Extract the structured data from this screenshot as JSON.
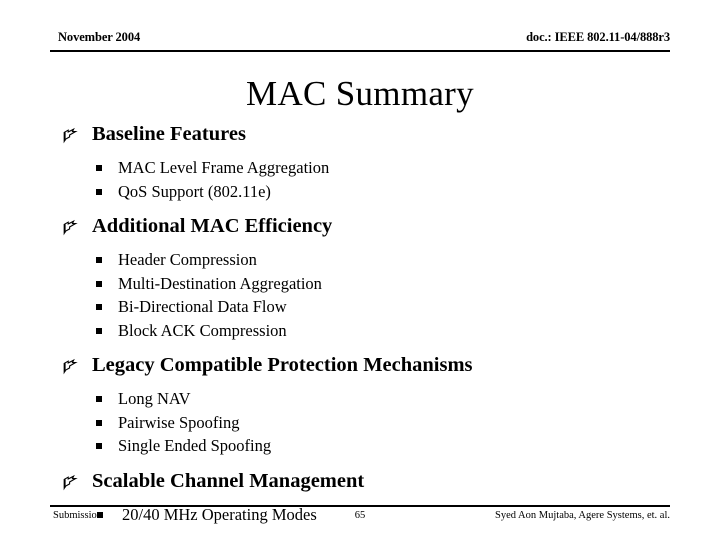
{
  "header": {
    "left": "November 2004",
    "right": "doc.: IEEE 802.11-04/888r3"
  },
  "title": "MAC Summary",
  "bullets": {
    "level1_icon": "pointing-hand-bullet",
    "level2_icon": "square-bullet"
  },
  "sections": [
    {
      "heading": "Baseline Features",
      "items": [
        "MAC Level Frame Aggregation",
        "QoS Support (802.11e)"
      ]
    },
    {
      "heading": "Additional MAC Efficiency",
      "items": [
        "Header Compression",
        "Multi-Destination Aggregation",
        "Bi-Directional Data Flow",
        "Block ACK Compression"
      ]
    },
    {
      "heading": "Legacy Compatible Protection Mechanisms",
      "items": [
        "Long NAV",
        "Pairwise Spoofing",
        "Single Ended Spoofing"
      ]
    },
    {
      "heading": "Scalable Channel Management",
      "items": [
        "20/40 MHz Operating Modes"
      ]
    }
  ],
  "footer": {
    "left": "Submission",
    "page": "65",
    "right": "Syed Aon Mujtaba, Agere Systems, et. al."
  }
}
